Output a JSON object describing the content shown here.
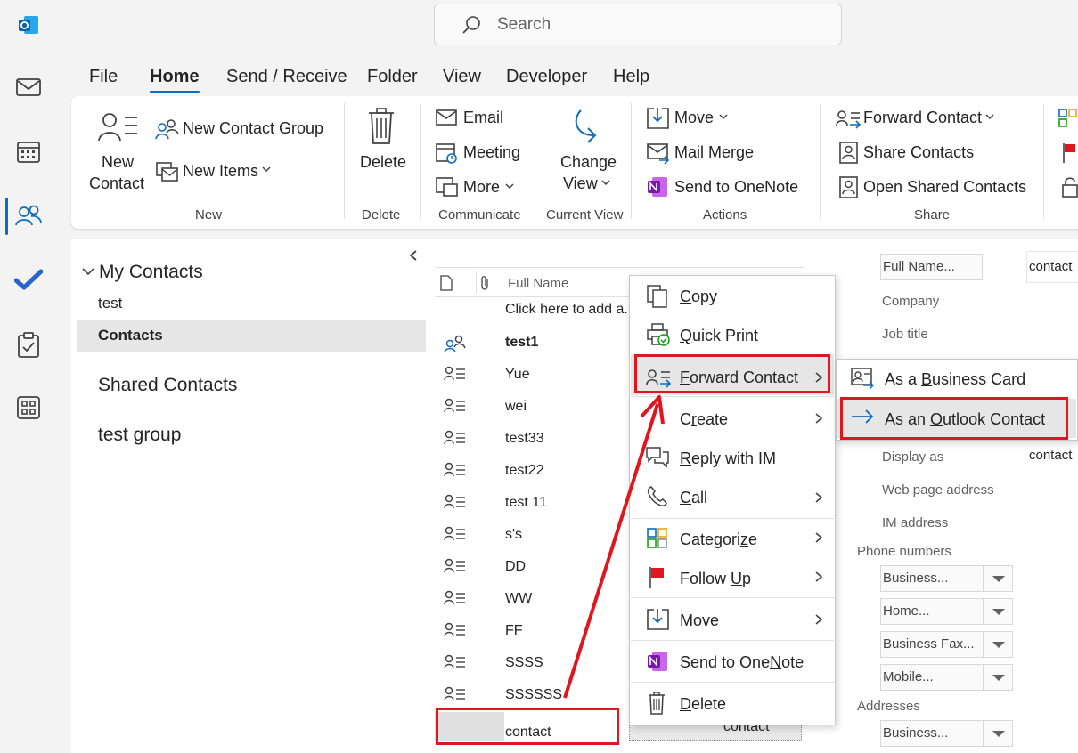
{
  "search": {
    "placeholder": "Search"
  },
  "tabs": [
    "File",
    "Home",
    "Send / Receive",
    "Folder",
    "View",
    "Developer",
    "Help"
  ],
  "ribbon": {
    "new_contact": [
      "New",
      "Contact"
    ],
    "new_contact_group": "New Contact Group",
    "new_items": "New Items",
    "delete": "Delete",
    "email": "Email",
    "meeting": "Meeting",
    "more": "More",
    "change_view": [
      "Change",
      "View"
    ],
    "move": "Move",
    "mail_merge": "Mail Merge",
    "send_to_onenote": "Send to OneNote",
    "forward_contact": "Forward Contact",
    "share_contacts": "Share Contacts",
    "open_shared_contacts": "Open Shared Contacts",
    "groups": [
      "New",
      "Delete",
      "Communicate",
      "Current View",
      "Actions",
      "Share"
    ]
  },
  "folders": {
    "my_contacts": "My Contacts",
    "items": [
      "test",
      "Contacts"
    ],
    "shared_contacts": "Shared Contacts",
    "test_group": "test group"
  },
  "list": {
    "column_full_name": "Full Name",
    "add_row": "Click here to add a...",
    "rows": [
      "test1",
      "Yue",
      "wei",
      "test33",
      "test22",
      "test 11",
      "s's",
      "DD",
      "WW",
      "FF",
      "SSSS",
      "SSSSSS",
      "contact"
    ],
    "selected_row_extra": "contact"
  },
  "context_menu": {
    "items": [
      "Copy",
      "Quick Print",
      "Forward Contact",
      "Create",
      "Reply with IM",
      "Call",
      "Categorize",
      "Follow Up",
      "Move",
      "Send to OneNote",
      "Delete"
    ]
  },
  "submenu": {
    "items": [
      "As a Business Card",
      "As an Outlook Contact"
    ]
  },
  "reading_pane": {
    "full_name_btn": "Full Name...",
    "full_name_value": "contact",
    "company": "Company",
    "job_title": "Job title",
    "display_as": "Display as",
    "display_as_value": "contact",
    "web_page": "Web page address",
    "im_address": "IM address",
    "phone_numbers": "Phone numbers",
    "phones": [
      "Business...",
      "Home...",
      "Business Fax...",
      "Mobile..."
    ],
    "addresses": "Addresses",
    "address_type": "Business..."
  },
  "colors": {
    "accent": "#0f6cbd",
    "highlight_red": "#e0161e",
    "onenote": "#7719aa"
  }
}
